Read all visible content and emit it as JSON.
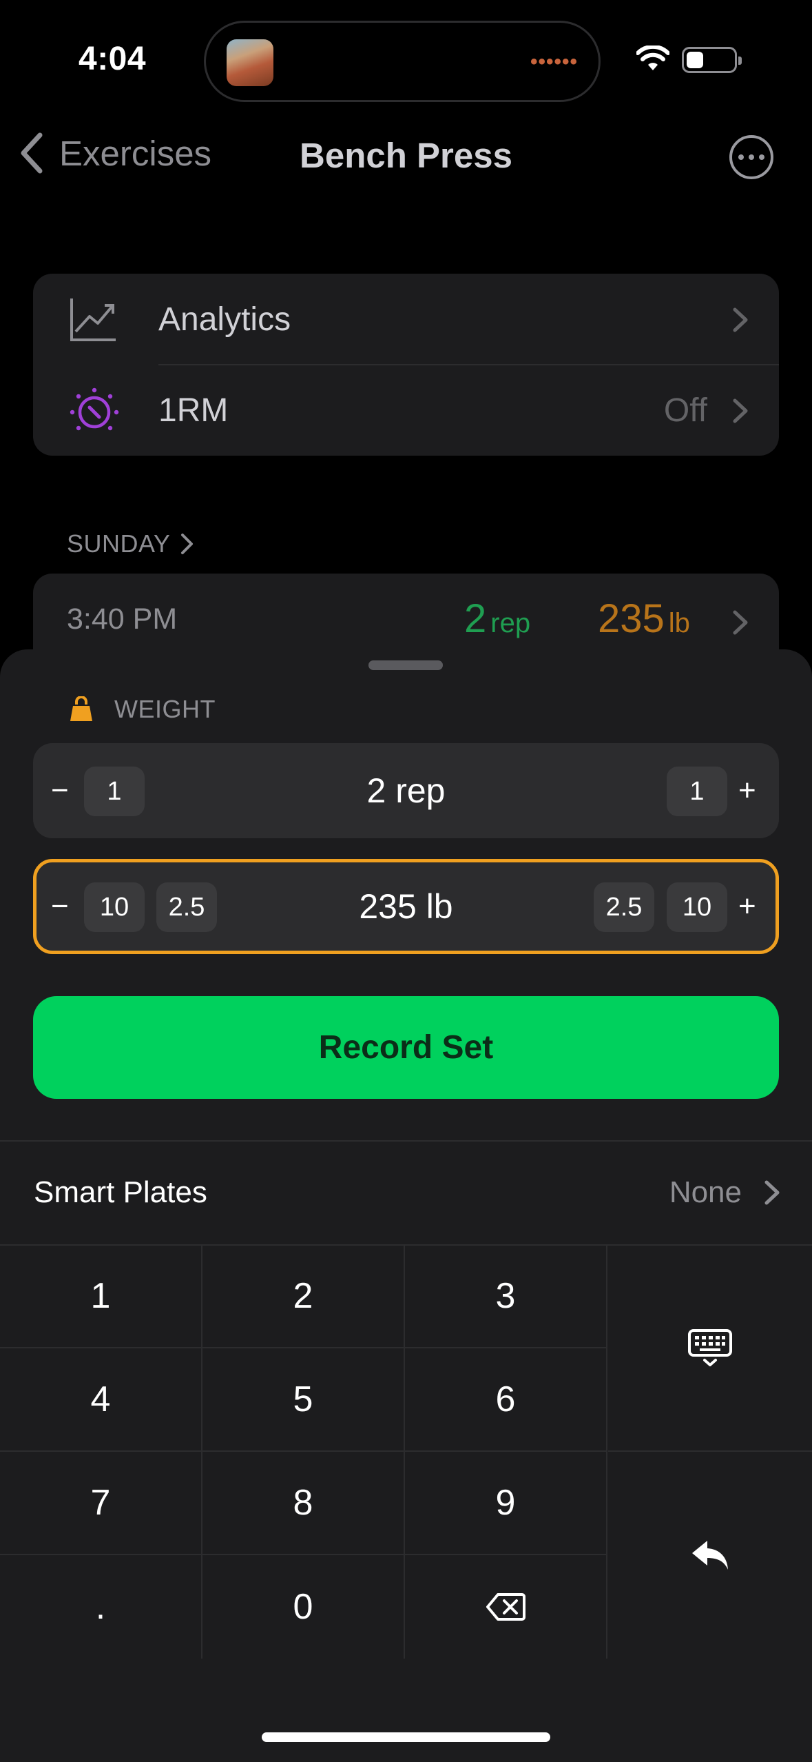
{
  "status_bar": {
    "time": "4:04"
  },
  "island": {
    "dots": "••••••"
  },
  "nav": {
    "back_label": "Exercises",
    "title": "Bench Press"
  },
  "settings": [
    {
      "label": "Analytics",
      "value": ""
    },
    {
      "label": "1RM",
      "value": "Off"
    }
  ],
  "section": {
    "label": "SUNDAY"
  },
  "log": {
    "time": "3:40 PM",
    "reps": "2",
    "reps_unit": "rep",
    "weight": "235",
    "weight_unit": "lb"
  },
  "sheet": {
    "label": "WEIGHT",
    "reps_stepper": {
      "minus": "−",
      "dec_small": "1",
      "value": "2 rep",
      "inc_small": "1",
      "plus": "+"
    },
    "weight_stepper": {
      "minus": "−",
      "dec_big": "10",
      "dec_small": "2.5",
      "value": "235 lb",
      "inc_small": "2.5",
      "inc_big": "10",
      "plus": "+"
    },
    "record_button": "Record Set",
    "smart_plates": {
      "label": "Smart Plates",
      "value": "None"
    }
  },
  "keypad": {
    "keys": [
      "1",
      "2",
      "3",
      "4",
      "5",
      "6",
      "7",
      "8",
      "9",
      ".",
      "0"
    ],
    "icons": [
      "backspace-icon",
      "keyboard-icon",
      "undo-icon"
    ]
  },
  "colors": {
    "accent_green": "#00d15d",
    "accent_orange": "#f0a020",
    "rep_green": "#1f9e51",
    "weight_orange": "#b8741a",
    "purple": "#a040d8"
  }
}
